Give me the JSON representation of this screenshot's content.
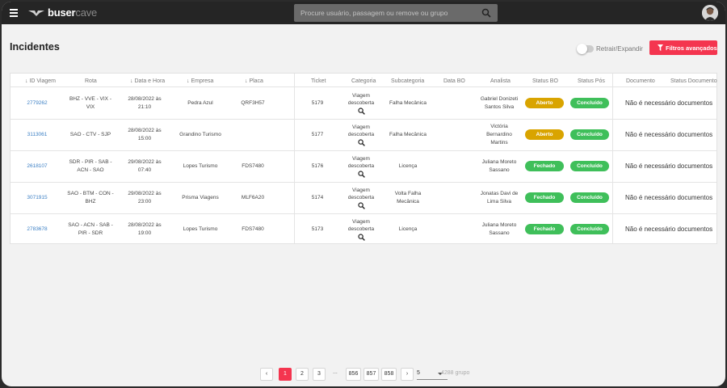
{
  "app": {
    "logo_bold": "buser",
    "logo_light": "cave",
    "search_placeholder": "Procure usuário, passagem ou remove ou grupo"
  },
  "page": {
    "title": "Incidentes",
    "toggle_label": "Retrair/Expandir",
    "toggle_on": false,
    "filter_button": "Filtros avançados"
  },
  "table": {
    "headers": {
      "id": "↓ ID Viagem",
      "rota": "Rota",
      "data": "↓ Data e Hora",
      "empresa": "↓ Empresa",
      "placa": "↓ Placa",
      "ticket": "Ticket",
      "categoria": "Categoria",
      "subcategoria": "Subcategoria",
      "data_bo": "Data BO",
      "analista": "Analista",
      "status_bo": "Status BO",
      "status_pos": "Status Pós",
      "documento": "Documento",
      "status_documento": "Status Documento"
    },
    "rows": [
      {
        "id": "2779262",
        "rota": "BHZ - VVE - VIX - VIX",
        "data": "28/08/2022 às 21:10",
        "empresa": "Pedra Azul",
        "placa": "QRF3H57",
        "ticket": "5179",
        "categoria": "Viagem descoberta",
        "subcategoria": "Falha Mecânica",
        "data_bo": "",
        "analista": "Gabriel Donizeti Santos Silva",
        "status_bo": "Aberto",
        "status_pos": "Concluído",
        "documento": "Não é necessário documentos"
      },
      {
        "id": "3113061",
        "rota": "SAO - CTV - SJP",
        "data": "28/08/2022 às 15:00",
        "empresa": "Grandino Turismo",
        "placa": "",
        "ticket": "5177",
        "categoria": "Viagem descoberta",
        "subcategoria": "Falha Mecânica",
        "data_bo": "",
        "analista": "Victória Bernardino Martins",
        "status_bo": "Aberto",
        "status_pos": "Concluído",
        "documento": "Não é necessário documentos"
      },
      {
        "id": "2618107",
        "rota": "SDR - PIR - SAB - ACN - SAO",
        "data": "29/08/2022 às 07:40",
        "empresa": "Lopes Turismo",
        "placa": "FDS7480",
        "ticket": "5176",
        "categoria": "Viagem descoberta",
        "subcategoria": "Licença",
        "data_bo": "",
        "analista": "Juliana Moreto Sassano",
        "status_bo": "Fechado",
        "status_pos": "Concluído",
        "documento": "Não é necessário documentos"
      },
      {
        "id": "3071915",
        "rota": "SAO - BTM - CON - BHZ",
        "data": "29/08/2022 às 23:00",
        "empresa": "Prisma Viagens",
        "placa": "MLF6A20",
        "ticket": "5174",
        "categoria": "Viagem descoberta",
        "subcategoria": "Volta Falha Mecânica",
        "data_bo": "",
        "analista": "Jonatas Davi de Lima Silva",
        "status_bo": "Fechado",
        "status_pos": "Concluído",
        "documento": "Não é necessário documentos"
      },
      {
        "id": "2783678",
        "rota": "SAO - ACN - SAB - PIR - SDR",
        "data": "28/08/2022 às 19:00",
        "empresa": "Lopes Turismo",
        "placa": "FDS7480",
        "ticket": "5173",
        "categoria": "Viagem descoberta",
        "subcategoria": "Licença",
        "data_bo": "",
        "analista": "Juliana Moreto Sassano",
        "status_bo": "Fechado",
        "status_pos": "Concluído",
        "documento": "Não é necessário documentos"
      }
    ]
  },
  "colors": {
    "aberto": "#d9a400",
    "fechado": "#3fbf5a",
    "concluido": "#3fbf5a",
    "accent": "#f4354f"
  },
  "pagination": {
    "prev": "‹",
    "pages": [
      "1",
      "2",
      "3"
    ],
    "ellipsis": "...",
    "last_pages": [
      "856",
      "857",
      "858"
    ],
    "next": "›",
    "per_page": "5",
    "total": "4288 grupo"
  }
}
